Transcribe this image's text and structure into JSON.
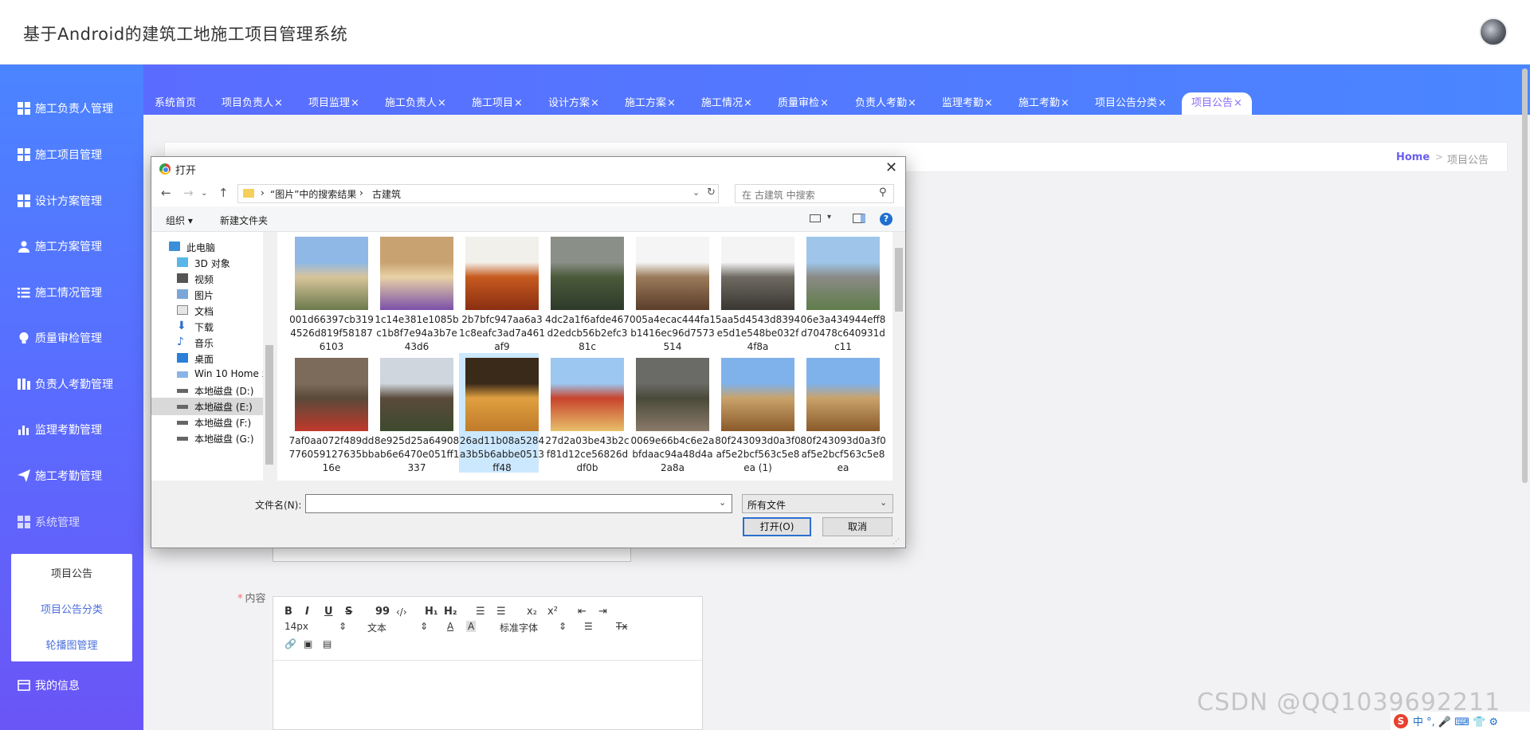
{
  "app": {
    "title": "基于Android的建筑工地施工项目管理系统"
  },
  "sidebar": {
    "items": [
      {
        "label": "施工负责人管理",
        "icon": "grid-icon"
      },
      {
        "label": "施工项目管理",
        "icon": "grid-icon"
      },
      {
        "label": "设计方案管理",
        "icon": "grid-icon"
      },
      {
        "label": "施工方案管理",
        "icon": "user-icon"
      },
      {
        "label": "施工情况管理",
        "icon": "list-icon"
      },
      {
        "label": "质量审检管理",
        "icon": "bulb-icon"
      },
      {
        "label": "负责人考勤管理",
        "icon": "columns-icon"
      },
      {
        "label": "监理考勤管理",
        "icon": "bar-chart-icon"
      },
      {
        "label": "施工考勤管理",
        "icon": "send-icon"
      },
      {
        "label": "系统管理",
        "icon": "grid-icon"
      },
      {
        "label": "我的信息",
        "icon": "card-icon"
      }
    ],
    "submenu": [
      "项目公告",
      "项目公告分类",
      "轮播图管理"
    ]
  },
  "tabs": [
    {
      "label": "系统首页",
      "close": ""
    },
    {
      "label": "项目负责人",
      "close": "×"
    },
    {
      "label": "项目监理",
      "close": "×"
    },
    {
      "label": "施工负责人",
      "close": "×"
    },
    {
      "label": "施工项目",
      "close": "×"
    },
    {
      "label": "设计方案",
      "close": "×"
    },
    {
      "label": "施工方案",
      "close": "×"
    },
    {
      "label": "施工情况",
      "close": "×"
    },
    {
      "label": "质量审检",
      "close": "×"
    },
    {
      "label": "负责人考勤",
      "close": "×"
    },
    {
      "label": "监理考勤",
      "close": "×"
    },
    {
      "label": "施工考勤",
      "close": "×"
    },
    {
      "label": "项目公告分类",
      "close": "×"
    },
    {
      "label": "项目公告",
      "close": "×"
    }
  ],
  "breadcrumb": {
    "home": "Home",
    "sep": ">",
    "current": "项目公告"
  },
  "form": {
    "content_label": "内容",
    "required_mark": "*"
  },
  "editor": {
    "bold": "B",
    "italic": "I",
    "underline": "U",
    "strike": "S",
    "quote": "99",
    "code": "‹/›",
    "h1": "H₁",
    "h2": "H₂",
    "ordered": "☰",
    "bullet": "☰",
    "sub": "x₂",
    "sup": "x²",
    "outdent": "⇤",
    "indent": "⇥",
    "font_size": "14px",
    "block": "文本",
    "font": "标准字体",
    "clear": "Tx"
  },
  "dialog": {
    "title": "打开",
    "address": {
      "seg1": "“图片”中的搜索结果",
      "seg2": "古建筑"
    },
    "search_placeholder": "在 古建筑 中搜索",
    "organize": "组织 ▾",
    "new_folder": "新建文件夹",
    "tree": [
      {
        "label": "此电脑",
        "icon": "computer-icon"
      },
      {
        "label": "3D 对象",
        "icon": "3d-objects-icon"
      },
      {
        "label": "视频",
        "icon": "video-icon"
      },
      {
        "label": "图片",
        "icon": "pictures-icon"
      },
      {
        "label": "文档",
        "icon": "documents-icon"
      },
      {
        "label": "下载",
        "icon": "download-icon"
      },
      {
        "label": "音乐",
        "icon": "music-icon"
      },
      {
        "label": "桌面",
        "icon": "desktop-icon"
      },
      {
        "label": "Win 10 Home x",
        "icon": "drive-icon"
      },
      {
        "label": "本地磁盘 (D:)",
        "icon": "drive-icon"
      },
      {
        "label": "本地磁盘 (E:)",
        "icon": "drive-icon"
      },
      {
        "label": "本地磁盘 (F:)",
        "icon": "drive-icon"
      },
      {
        "label": "本地磁盘 (G:)",
        "icon": "drive-icon"
      }
    ],
    "files": [
      {
        "name": "001d66397cb3194526d819f581876103",
        "thumb": [
          "#8fb8e6",
          "#d7c49a",
          "#6b7a4d"
        ]
      },
      {
        "name": "1c14e381e1085bc1b8f7e94a3b7e43d6",
        "thumb": [
          "#c9a271",
          "#e8d2a6",
          "#7a4fa8"
        ]
      },
      {
        "name": "2b7bfc947aa6a31c8eafc3ad7a461af9",
        "thumb": [
          "#f2f0ea",
          "#c65a1e",
          "#8a2e12"
        ]
      },
      {
        "name": "4dc2a1f6afde467d2edcb56b2efc381c",
        "thumb": [
          "#8a8f87",
          "#4a5a3a",
          "#2e3a2a"
        ]
      },
      {
        "name": "005a4ecac444fa1b1416ec96d7573514",
        "thumb": [
          "#f5f5f5",
          "#9a7a5a",
          "#5a3e2a"
        ]
      },
      {
        "name": "5aa5d4543d8394e5d1e548be032f4f8a",
        "thumb": [
          "#f4f4f4",
          "#6e6a62",
          "#3a3732"
        ]
      },
      {
        "name": "06e3a434944eff8d70478c640931dc11",
        "thumb": [
          "#9fc6ea",
          "#8a8a86",
          "#5f7d4a"
        ]
      },
      {
        "name": "7af0aa072f489dd776059127635bb16e",
        "thumb": [
          "#7c6a5a",
          "#5a4a3a",
          "#c0392b"
        ]
      },
      {
        "name": "8e925d25a64908ab6e6470e051ff1337",
        "thumb": [
          "#cfd6de",
          "#5a4a3a",
          "#3d4a2e"
        ]
      },
      {
        "name": "26ad11b08a5284a3b5b6abbe0513ff48",
        "thumb": [
          "#3a2a1a",
          "#e0a040",
          "#c07a2a"
        ]
      },
      {
        "name": "27d2a03be43b2cf81d12ce56826ddf0b",
        "thumb": [
          "#9cc7f0",
          "#c8432c",
          "#e7c06a"
        ]
      },
      {
        "name": "0069e66b4c6e2abfdaac94a48d4a2a8a",
        "thumb": [
          "#6a6a66",
          "#4a4a3a",
          "#8a7a6a"
        ]
      },
      {
        "name": "80f243093d0a3f0af5e2bcf563c5e8ea (1)",
        "thumb": [
          "#7fb2ea",
          "#c9a26a",
          "#8a5a2a"
        ]
      },
      {
        "name": "80f243093d0a3f0af5e2bcf563c5e8ea",
        "thumb": [
          "#7fb2ea",
          "#c9a26a",
          "#8a5a2a"
        ]
      }
    ],
    "filename_label": "文件名(N):",
    "filename_value": "",
    "filetype": "所有文件",
    "open_btn": "打开(O)",
    "cancel_btn": "取消"
  },
  "watermark": "CSDN @QQ1039692211",
  "ime": {
    "logo": "S",
    "label": "中 °, 🎤 ⌨ 👕 ⚙"
  },
  "colors": {
    "accent": "#5a6cff",
    "tab_active_text": "#8a6cf6",
    "link": "#4a6fdc"
  }
}
